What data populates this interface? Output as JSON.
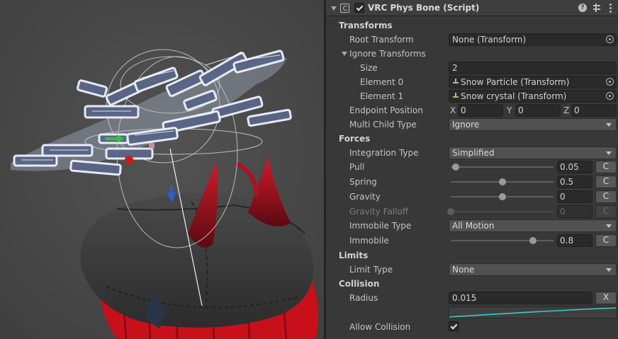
{
  "component": {
    "title": "VRC Phys Bone (Script)",
    "enabled": true,
    "help_icon": "question-icon",
    "preset_icon": "preset-sliders-icon",
    "menu_icon": "kebab-menu-icon"
  },
  "sections": {
    "transforms": "Transforms",
    "forces": "Forces",
    "limits": "Limits",
    "collision": "Collision"
  },
  "transforms": {
    "root_label": "Root Transform",
    "root_value": "None (Transform)",
    "ignore_label": "Ignore Transforms",
    "size_label": "Size",
    "size_value": "2",
    "elements": [
      {
        "label": "Element 0",
        "value": "Snow Particle (Transform)"
      },
      {
        "label": "Element 1",
        "value": "Snow crystal (Transform)"
      }
    ],
    "endpoint_label": "Endpoint Position",
    "endpoint": {
      "x_label": "X",
      "x": "0",
      "y_label": "Y",
      "y": "0",
      "z_label": "Z",
      "z": "0"
    },
    "multi_child_label": "Multi Child Type",
    "multi_child_value": "Ignore"
  },
  "forces": {
    "integration_label": "Integration Type",
    "integration_value": "Simplified",
    "pull": {
      "label": "Pull",
      "value": "0.05",
      "fraction": 0.05,
      "curve_button": "C"
    },
    "spring": {
      "label": "Spring",
      "value": "0.5",
      "fraction": 0.5,
      "curve_button": "C"
    },
    "gravity": {
      "label": "Gravity",
      "value": "0",
      "fraction": 0.5,
      "curve_button": "C"
    },
    "gravity_falloff": {
      "label": "Gravity Falloff",
      "value": "0",
      "fraction": 0.0,
      "curve_button": "C"
    },
    "immobile_type_label": "Immobile Type",
    "immobile_type_value": "All Motion",
    "immobile": {
      "label": "Immobile",
      "value": "0.8",
      "fraction": 0.8,
      "curve_button": "C"
    }
  },
  "limits": {
    "limit_type_label": "Limit Type",
    "limit_type_value": "None"
  },
  "collision": {
    "radius_label": "Radius",
    "radius_value": "0.015",
    "radius_clear_button": "X",
    "allow_collision_label": "Allow Collision",
    "allow_collision": true
  },
  "colors": {
    "accent_curve": "#3fc7d0",
    "hair_red": "#c8101b",
    "gizmo_blue": "#2563d6"
  }
}
